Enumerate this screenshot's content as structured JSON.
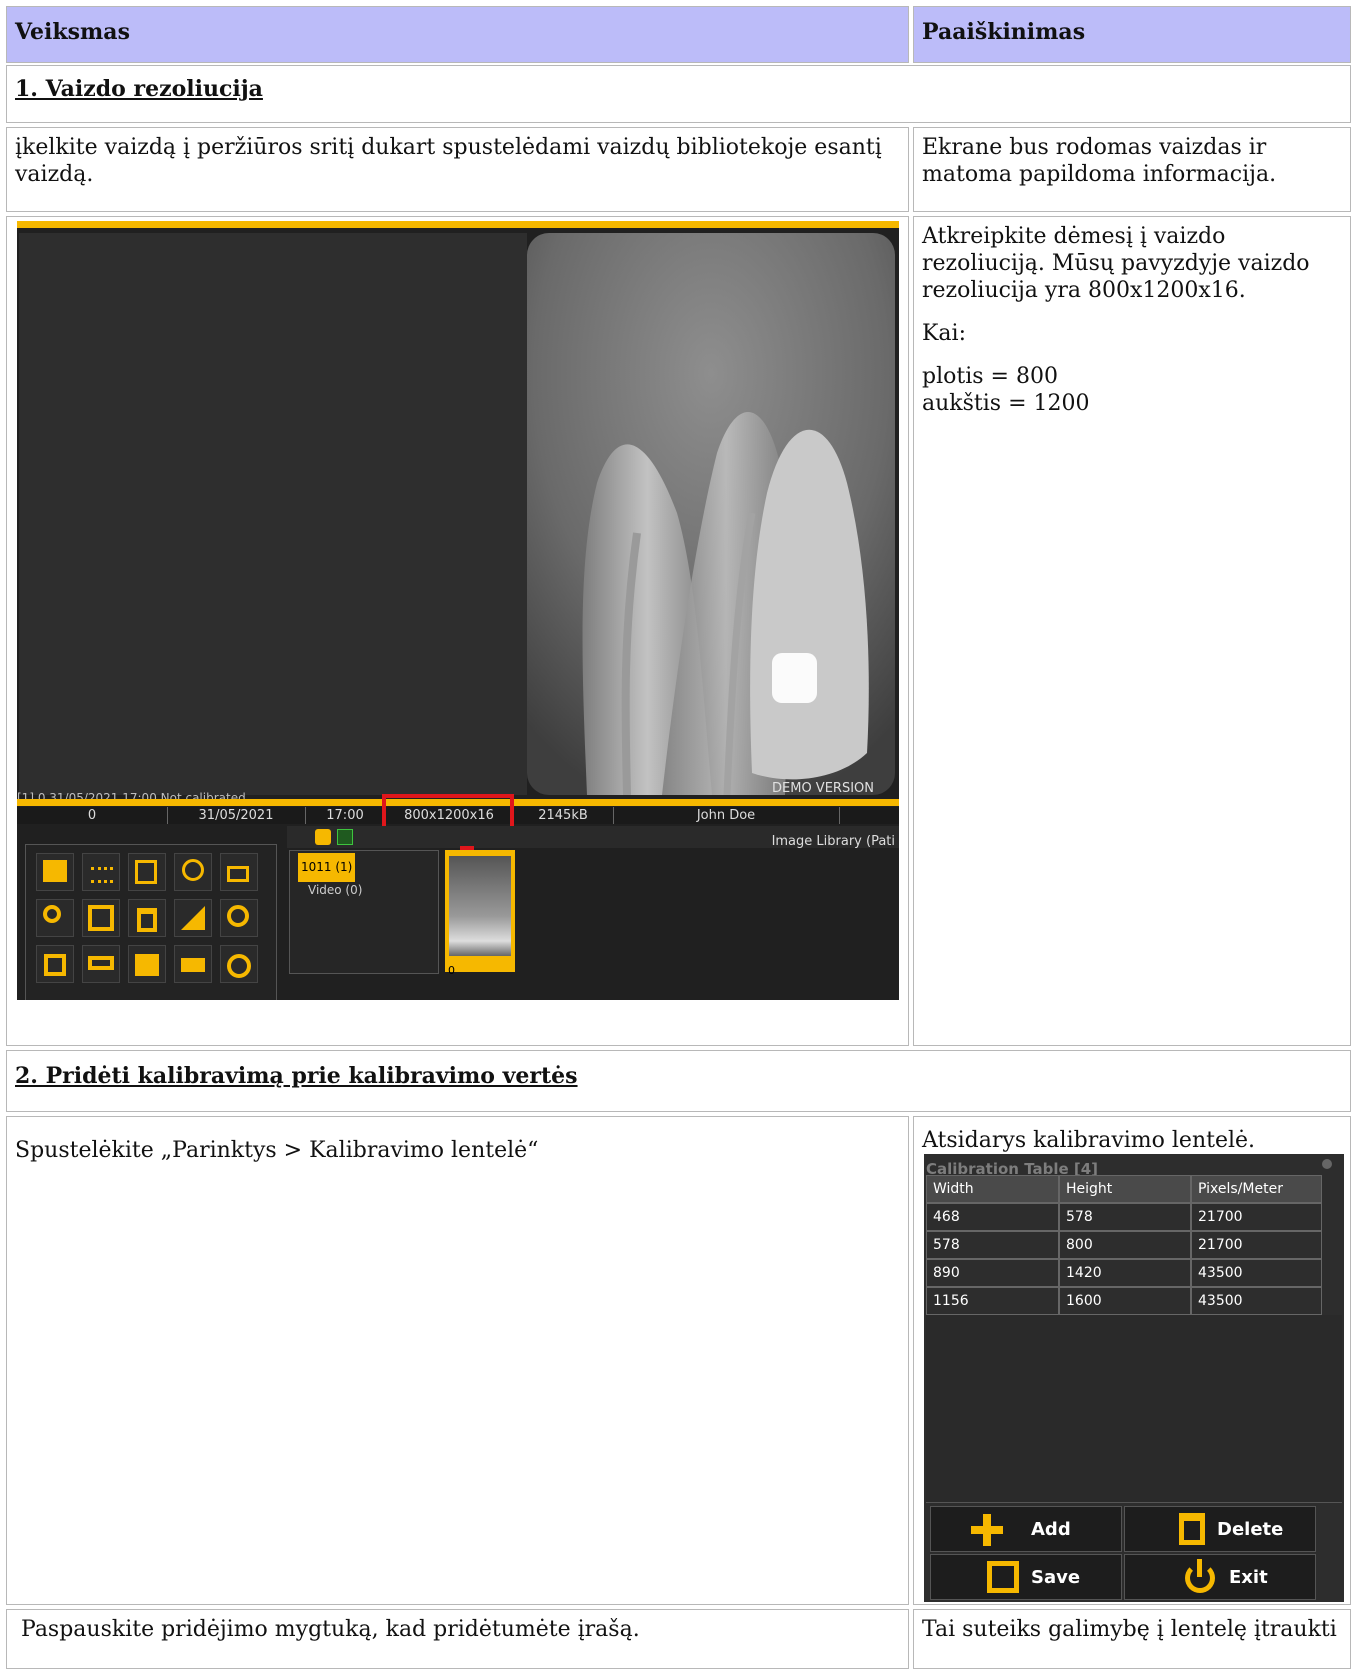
{
  "header": {
    "action": "Veiksmas",
    "explanation": "Paaiškinimas"
  },
  "section1": {
    "title": "1. Vaizdo rezoliucija",
    "step_text": "įkelkite vaizdą į peržiūros sritį dukart spustelėdami vaizdų bibliotekoje esantį vaizdą.",
    "step_expl": "Ekrane bus rodomas vaizdas ir matoma papildoma informacija.",
    "expl_p1": "Atkreipkite dėmesį į vaizdo rezoliuciją. Mūsų pavyzdyje vaizdo rezoliucija yra 800x1200x16.",
    "expl_p2": "Kai:",
    "expl_p3a": "plotis = 800",
    "expl_p3b": "aukštis = 1200",
    "app": {
      "watermark": "DEMO VERSION",
      "overlay_info": "[1] 0 31/05/2021 17:00 Not calibrated",
      "status": [
        "0",
        "31/05/2021",
        "17:00",
        "800x1200x16",
        "2145kB",
        "John Doe"
      ],
      "library_label": "Image Library (Pati",
      "tree_selected": "1011 (1)",
      "tree_video": "Video (0)",
      "thumb_index": "0",
      "highlight_color": "#e0161b",
      "accent_color": "#f6b800"
    }
  },
  "section2": {
    "title": "2. Pridėti kalibravimą prie kalibravimo vertės",
    "step_text": "Spustelėkite „Parinktys > Kalibravimo lentelė“",
    "step_expl": "Atsidarys kalibravimo lentelė.",
    "calib": {
      "title": "Calibration Table [4]",
      "columns": [
        "Width",
        "Height",
        "Pixels/Meter"
      ],
      "rows": [
        [
          "468",
          "578",
          "21700"
        ],
        [
          "578",
          "800",
          "21700"
        ],
        [
          "890",
          "1420",
          "43500"
        ],
        [
          "1156",
          "1600",
          "43500"
        ]
      ],
      "buttons": {
        "add": "Add",
        "delete": "Delete",
        "save": "Save",
        "exit": "Exit"
      }
    }
  },
  "section3": {
    "step_text": "Paspauskite pridėjimo mygtuką, kad pridėtumėte įrašą.",
    "step_expl": "Tai suteiks galimybę į lentelę įtraukti"
  }
}
